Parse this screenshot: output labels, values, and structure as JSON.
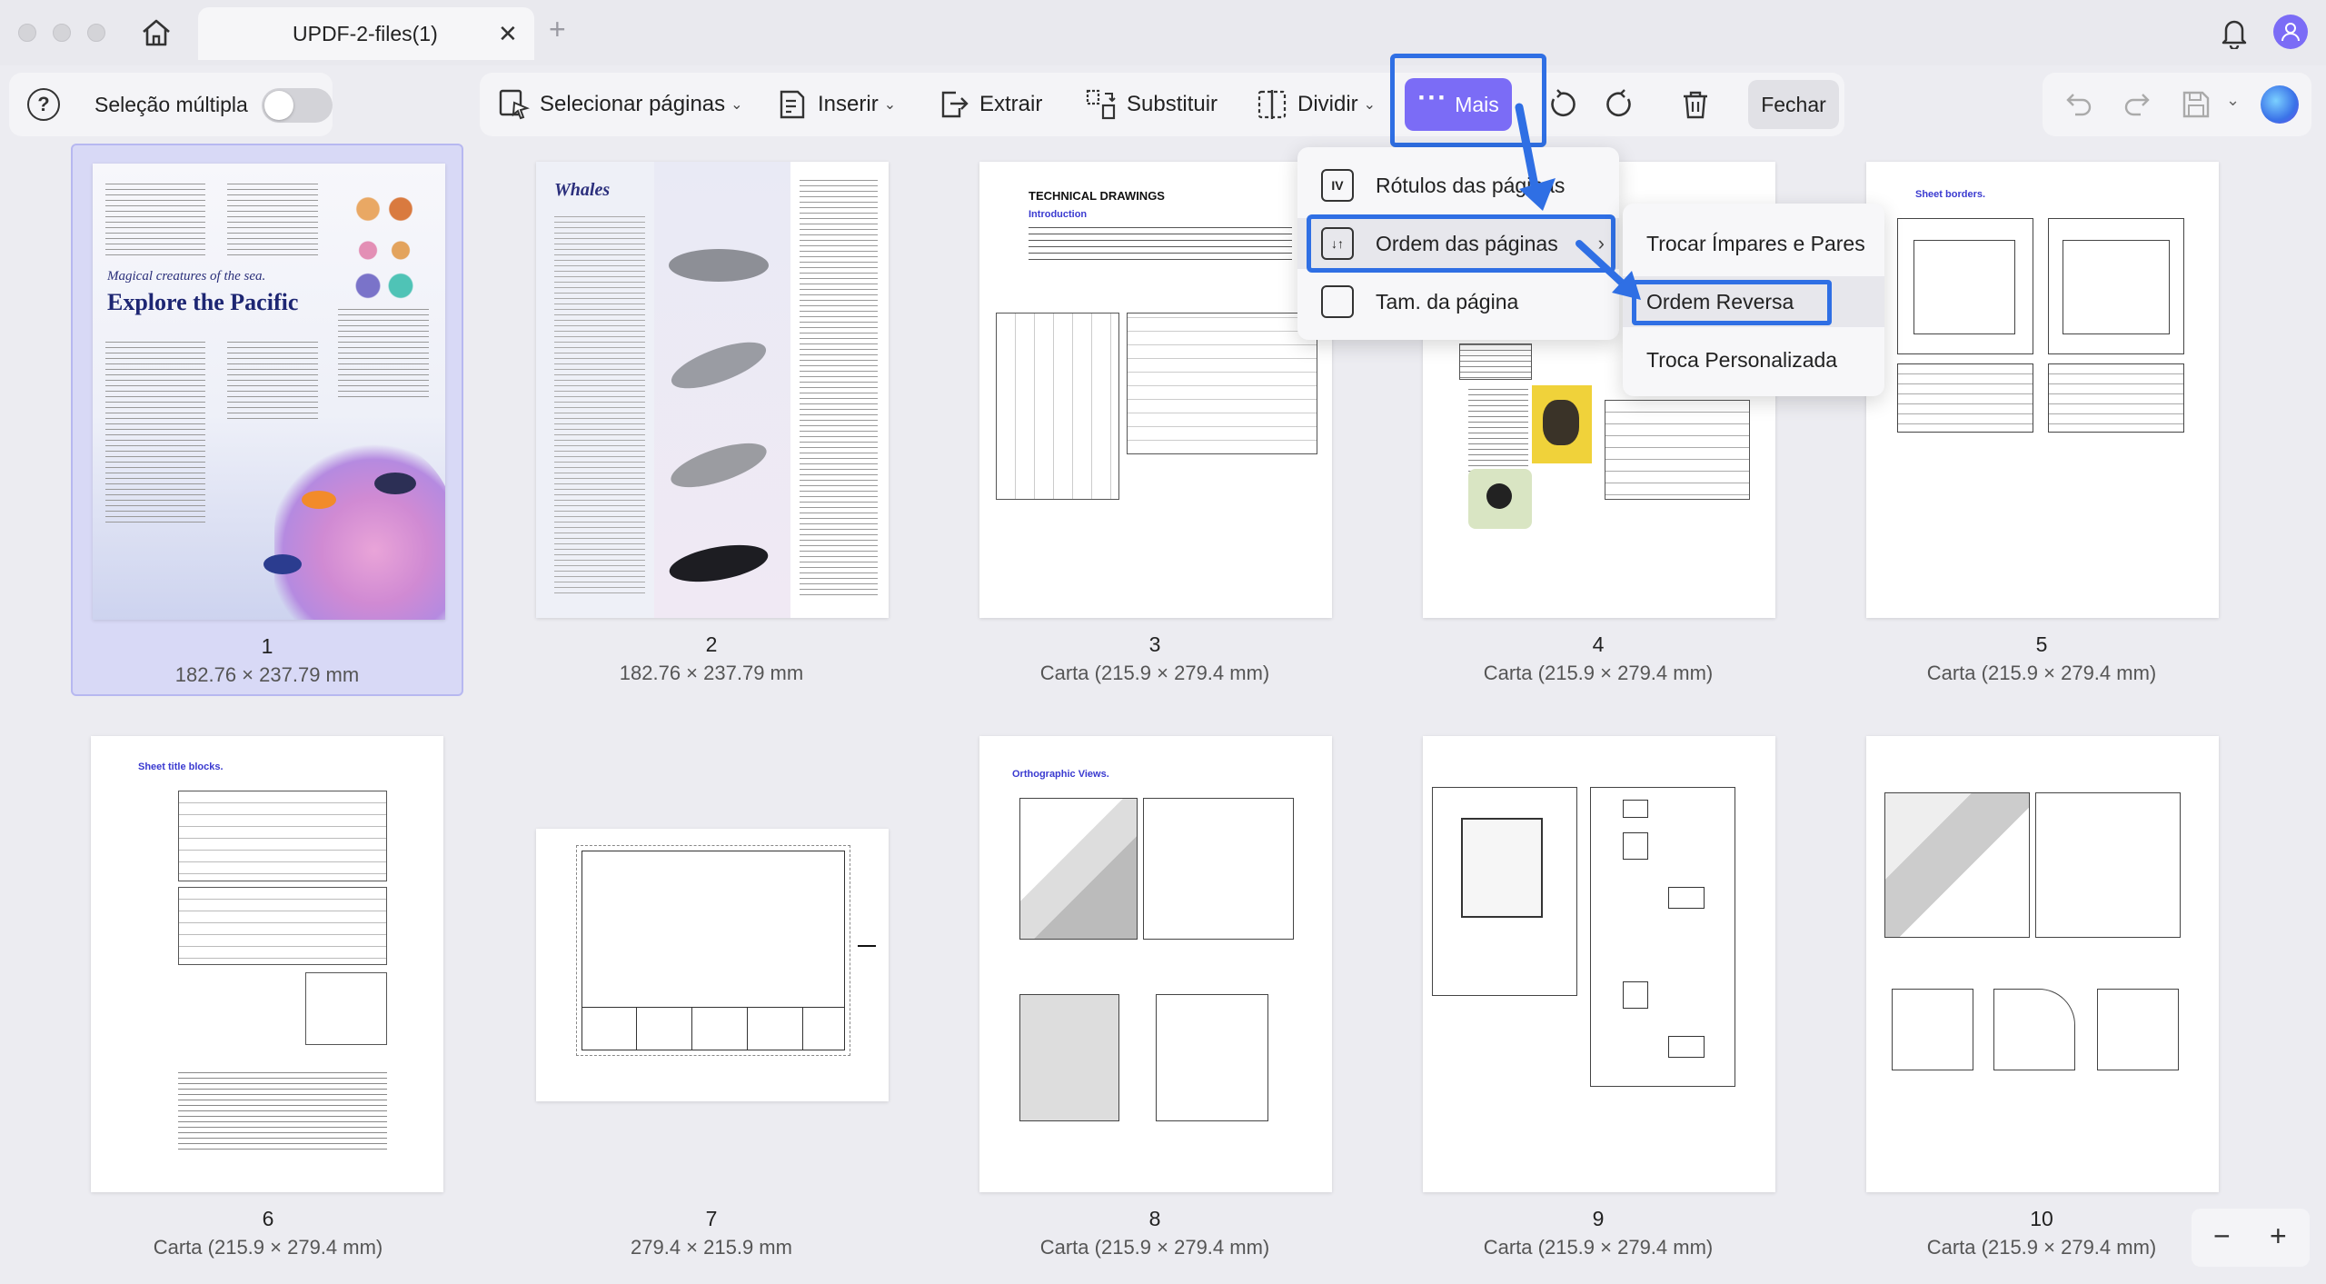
{
  "window": {
    "tab_title": "UPDF-2-files(1)",
    "tab_close": "✕",
    "tab_add": "+"
  },
  "toolbar": {
    "multi_select_label": "Seleção múltipla",
    "select_pages": "Selecionar páginas",
    "insert": "Inserir",
    "extract": "Extrair",
    "replace": "Substituir",
    "split": "Dividir",
    "more": "Mais",
    "close": "Fechar"
  },
  "more_menu": {
    "items": [
      {
        "label": "Rótulos das páginas",
        "icon": "IV"
      },
      {
        "label": "Ordem das páginas"
      },
      {
        "label": "Tam. da página"
      }
    ]
  },
  "order_submenu": {
    "items": [
      {
        "label": "Trocar Ímpares e Pares"
      },
      {
        "label": "Ordem Reversa"
      },
      {
        "label": "Troca Personalizada"
      }
    ]
  },
  "pages": [
    {
      "number": "1",
      "size": "182.76 × 237.79 mm"
    },
    {
      "number": "2",
      "size": "182.76 × 237.79 mm"
    },
    {
      "number": "3",
      "size": "Carta (215.9 × 279.4 mm)"
    },
    {
      "number": "4",
      "size": "Carta (215.9 × 279.4 mm)"
    },
    {
      "number": "5",
      "size": "Carta (215.9 × 279.4 mm)"
    },
    {
      "number": "6",
      "size": "Carta (215.9 × 279.4 mm)"
    },
    {
      "number": "7",
      "size": "279.4 × 215.9 mm"
    },
    {
      "number": "8",
      "size": "Carta (215.9 × 279.4 mm)"
    },
    {
      "number": "9",
      "size": "Carta (215.9 × 279.4 mm)"
    },
    {
      "number": "10",
      "size": "Carta (215.9 × 279.4 mm)"
    }
  ],
  "thumb_text": {
    "p1_subtitle": "Magical creatures of the sea.",
    "p1_title": "Explore the Pacific",
    "p2_title": "Whales",
    "p3_title": "TECHNICAL DRAWINGS",
    "p3_intro": "Introduction",
    "p5_title": "Sheet borders.",
    "p6_title": "Sheet title blocks.",
    "p8_title": "Orthographic Views."
  },
  "zoom": {
    "minus": "−",
    "plus": "+"
  },
  "colors": {
    "accent": "#7b6cf6",
    "highlight": "#2f6fe4",
    "selected_card": "#d8d9f6"
  }
}
